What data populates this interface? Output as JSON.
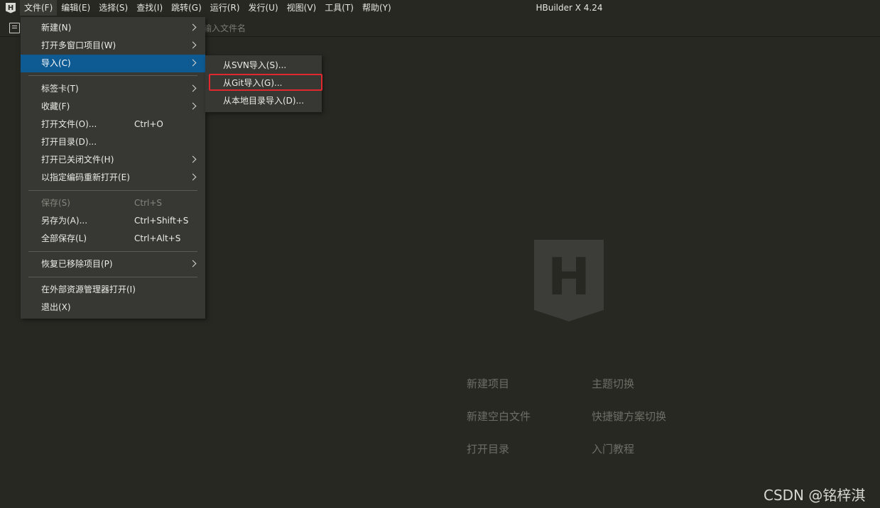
{
  "window": {
    "title": "HBuilder X 4.24"
  },
  "menubar": {
    "items": [
      "文件(F)",
      "编辑(E)",
      "选择(S)",
      "查找(I)",
      "跳转(G)",
      "运行(R)",
      "发行(U)",
      "视图(V)",
      "工具(T)",
      "帮助(Y)"
    ]
  },
  "toolbar": {
    "search_placeholder": "输入文件名"
  },
  "file_menu": {
    "items": [
      {
        "label": "新建(N)",
        "shortcut": "",
        "submenu": true
      },
      {
        "label": "打开多窗口项目(W)",
        "shortcut": "",
        "submenu": true
      },
      {
        "label": "导入(C)",
        "shortcut": "",
        "submenu": true,
        "highlighted": true
      },
      {
        "label": "标签卡(T)",
        "shortcut": "",
        "submenu": true
      },
      {
        "label": "收藏(F)",
        "shortcut": "",
        "submenu": true
      },
      {
        "label": "打开文件(O)...",
        "shortcut": "Ctrl+O",
        "submenu": false
      },
      {
        "label": "打开目录(D)...",
        "shortcut": "",
        "submenu": false
      },
      {
        "label": "打开已关闭文件(H)",
        "shortcut": "",
        "submenu": true
      },
      {
        "label": "以指定编码重新打开(E)",
        "shortcut": "",
        "submenu": true
      },
      {
        "label": "保存(S)",
        "shortcut": "Ctrl+S",
        "submenu": false,
        "disabled": true
      },
      {
        "label": "另存为(A)...",
        "shortcut": "Ctrl+Shift+S",
        "submenu": false
      },
      {
        "label": "全部保存(L)",
        "shortcut": "Ctrl+Alt+S",
        "submenu": false
      },
      {
        "label": "恢复已移除项目(P)",
        "shortcut": "",
        "submenu": true
      },
      {
        "label": "在外部资源管理器打开(I)",
        "shortcut": "",
        "submenu": false
      },
      {
        "label": "退出(X)",
        "shortcut": "",
        "submenu": false
      }
    ]
  },
  "import_submenu": {
    "items": [
      "从SVN导入(S)...",
      "从Git导入(G)...",
      "从本地目录导入(D)..."
    ],
    "outlined_item": "从Git导入(G)..."
  },
  "welcome": {
    "logo_letter": "H",
    "links": [
      "新建项目",
      "主题切换",
      "新建空白文件",
      "快捷键方案切换",
      "打开目录",
      "入门教程"
    ]
  },
  "watermark": "CSDN @铭梓淇",
  "colors": {
    "background": "#272822",
    "menu_background": "#373833",
    "highlight": "#0e5b94",
    "outline": "#e0282e"
  }
}
